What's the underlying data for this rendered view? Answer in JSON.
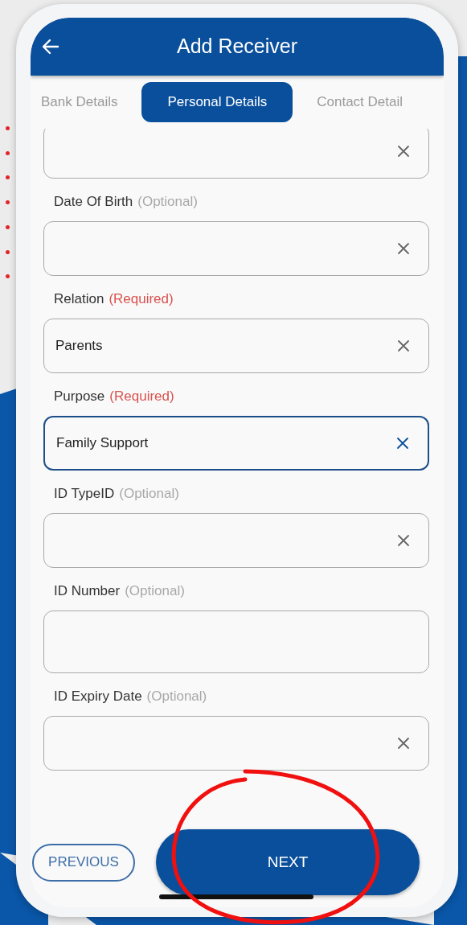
{
  "header": {
    "title": "Add Receiver"
  },
  "tabs": [
    {
      "label": "Bank Details",
      "selected": false
    },
    {
      "label": "Personal Details",
      "selected": true
    },
    {
      "label": "Contact Detail",
      "selected": false
    }
  ],
  "fields": [
    {
      "clearable": true,
      "focused": false
    },
    {
      "label": "Date Of Birth",
      "tag": "(Optional)",
      "kind": "optional",
      "clearable": true,
      "focused": false
    },
    {
      "label": "Relation",
      "tag": "(Required)",
      "kind": "required",
      "value": "Parents",
      "clearable": true,
      "focused": false
    },
    {
      "label": "Purpose",
      "tag": "(Required)",
      "kind": "required",
      "value": "Family Support",
      "clearable": true,
      "focused": true
    },
    {
      "label": "ID TypeID",
      "tag": "(Optional)",
      "kind": "optional",
      "clearable": true,
      "focused": false
    },
    {
      "label": "ID Number",
      "tag": "(Optional)",
      "kind": "optional",
      "clearable": false,
      "focused": false
    },
    {
      "label": "ID Expiry Date",
      "tag": "(Optional)",
      "kind": "optional",
      "clearable": true,
      "focused": false
    }
  ],
  "buttons": {
    "previous": "PREVIOUS",
    "next": "NEXT"
  }
}
